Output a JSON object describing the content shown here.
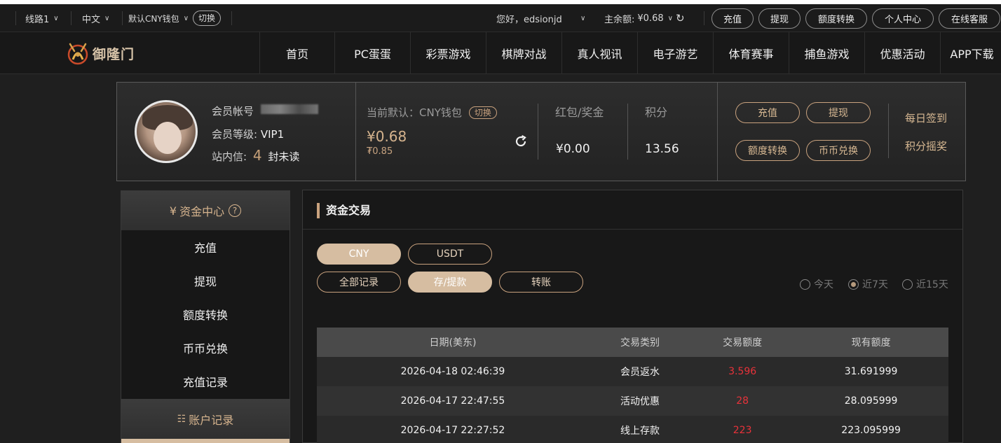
{
  "topbar": {
    "line": "线路1",
    "language": "中文",
    "wallet": "默认CNY钱包",
    "switch_label": "切换",
    "greeting": "您好，edsionjd",
    "balance_label": "主余额:",
    "balance_value": "¥0.68",
    "buttons": [
      "充值",
      "提现",
      "额度转换",
      "个人中心",
      "在线客服"
    ]
  },
  "nav": {
    "logo_text": "御隆门",
    "items": [
      "首页",
      "PC蛋蛋",
      "彩票游戏",
      "棋牌对战",
      "真人视讯",
      "电子游艺",
      "体育赛事",
      "捕鱼游戏",
      "优惠活动",
      "APP下载"
    ]
  },
  "user": {
    "account_label": "会员帐号",
    "level_label": "会员等级:",
    "level_value": "VIP1",
    "inbox_label": "站内信:",
    "unread_count": "4",
    "unread_suffix": "封未读"
  },
  "wallet": {
    "current_label": "当前默认：CNY钱包",
    "switch_label": "切换",
    "main_amount": "¥0.68",
    "sub_amount": "₮0.85",
    "bonus_label": "红包/奖金",
    "bonus_value": "¥0.00",
    "points_label": "积分",
    "points_value": "13.56"
  },
  "actions": {
    "deposit": "充值",
    "withdraw": "提现",
    "transfer": "额度转换",
    "coin_exchange": "币币兑换",
    "daily_checkin": "每日签到",
    "points_lottery": "积分摇奖"
  },
  "sidebar": {
    "header": "资金中心",
    "items": [
      "充值",
      "提现",
      "额度转换",
      "币币兑换",
      "充值记录"
    ],
    "footer": "账户记录"
  },
  "content": {
    "title": "资金交易",
    "currency_tabs": [
      "CNY",
      "USDT"
    ],
    "record_tabs": [
      "全部记录",
      "存/提款",
      "转账"
    ],
    "periods": [
      "今天",
      "近7天",
      "近15天"
    ],
    "selected_period": "近7天",
    "columns": [
      "日期(美东)",
      "交易类别",
      "交易额度",
      "现有额度"
    ],
    "rows": [
      [
        "2026-04-18 02:46:39",
        "会员返水",
        "3.596",
        "31.691999"
      ],
      [
        "2026-04-17 22:47:55",
        "活动优惠",
        "28",
        "28.095999"
      ],
      [
        "2026-04-17 22:27:52",
        "线上存款",
        "223",
        "223.095999"
      ]
    ]
  },
  "colors": {
    "accent_gold": "#c9a27e",
    "amount_red": "#e8323a",
    "background": "#1f1f1f"
  }
}
